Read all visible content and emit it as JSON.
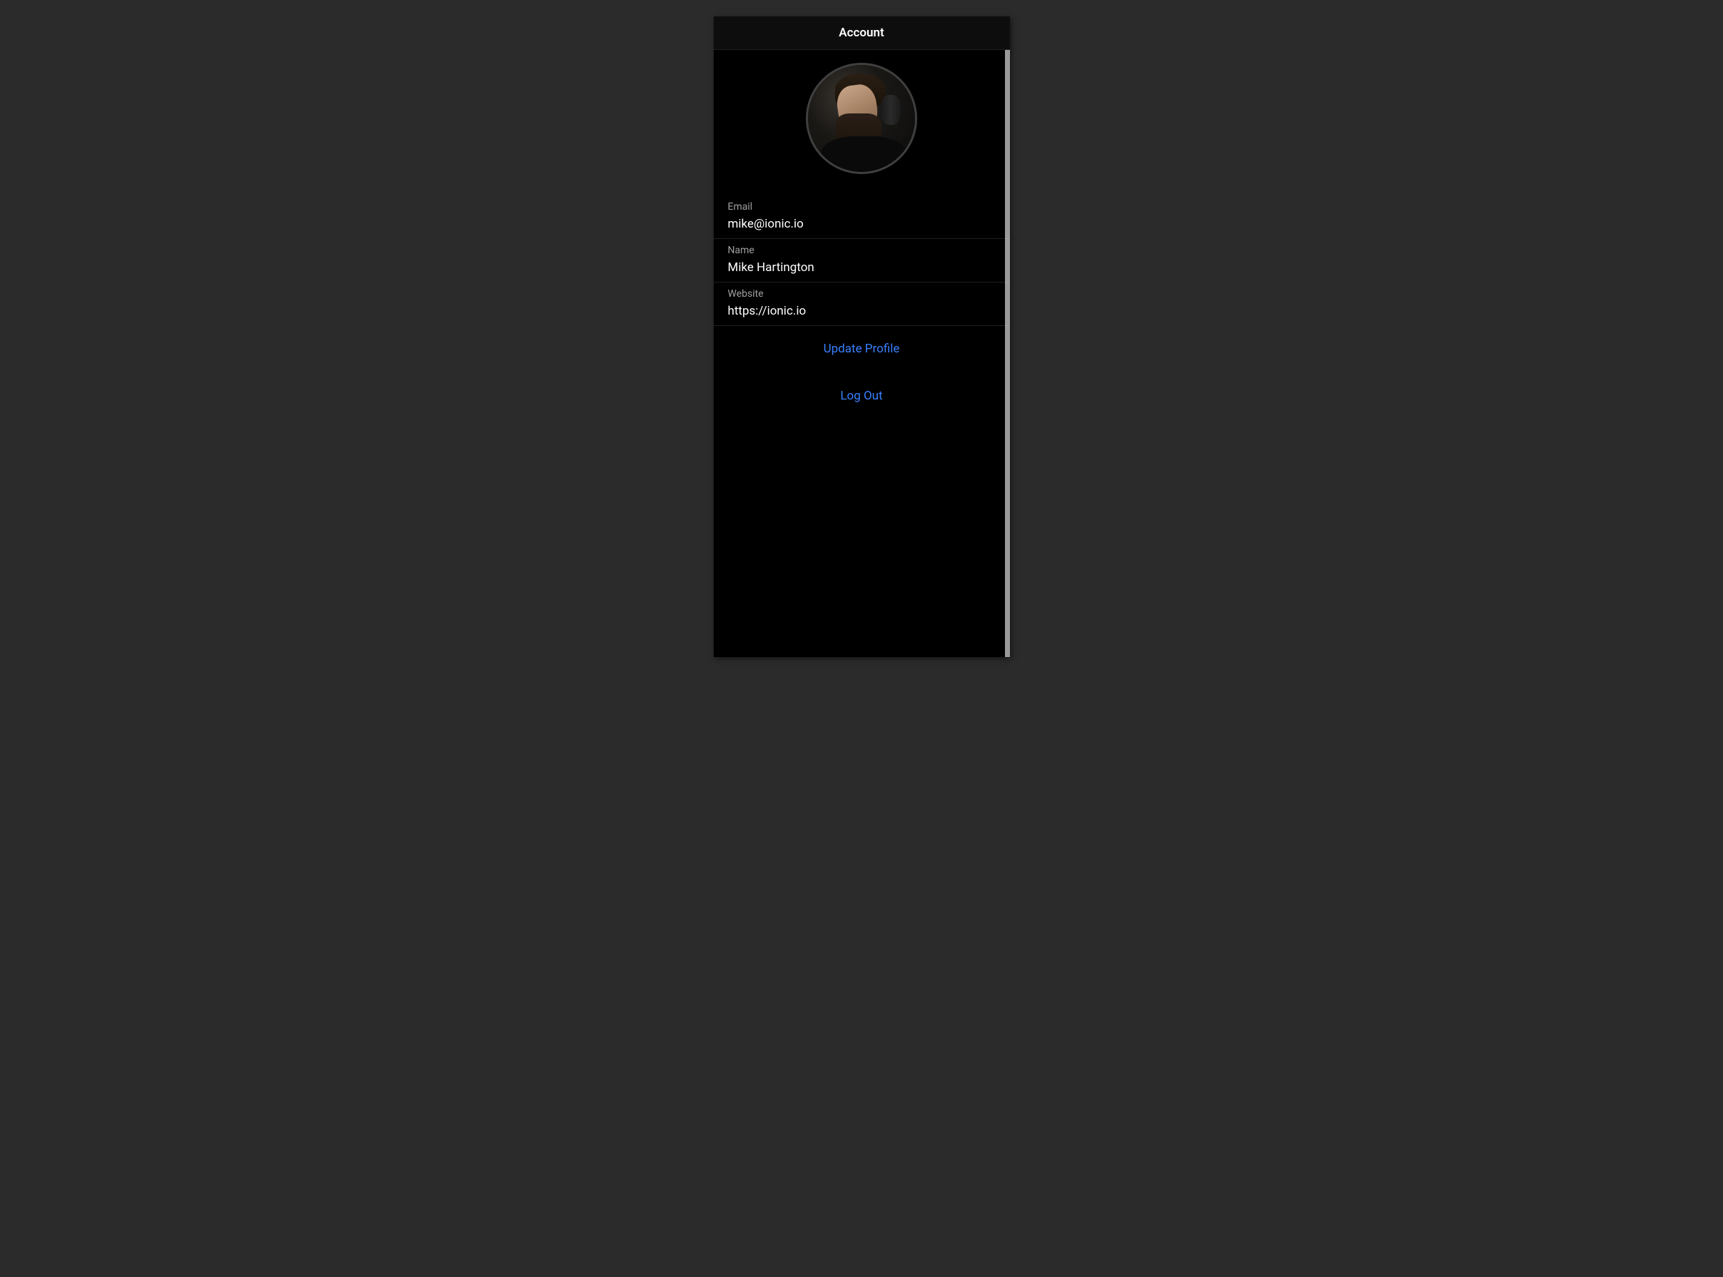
{
  "header": {
    "title": "Account"
  },
  "profile": {
    "avatar_alt": "user-avatar"
  },
  "form": {
    "email": {
      "label": "Email",
      "value": "mike@ionic.io"
    },
    "name": {
      "label": "Name",
      "value": "Mike Hartington"
    },
    "website": {
      "label": "Website",
      "value": "https://ionic.io"
    }
  },
  "actions": {
    "update_profile": "Update Profile",
    "log_out": "Log Out"
  },
  "colors": {
    "accent": "#3880ff",
    "background": "#000000",
    "page_background": "#2b2b2b"
  }
}
